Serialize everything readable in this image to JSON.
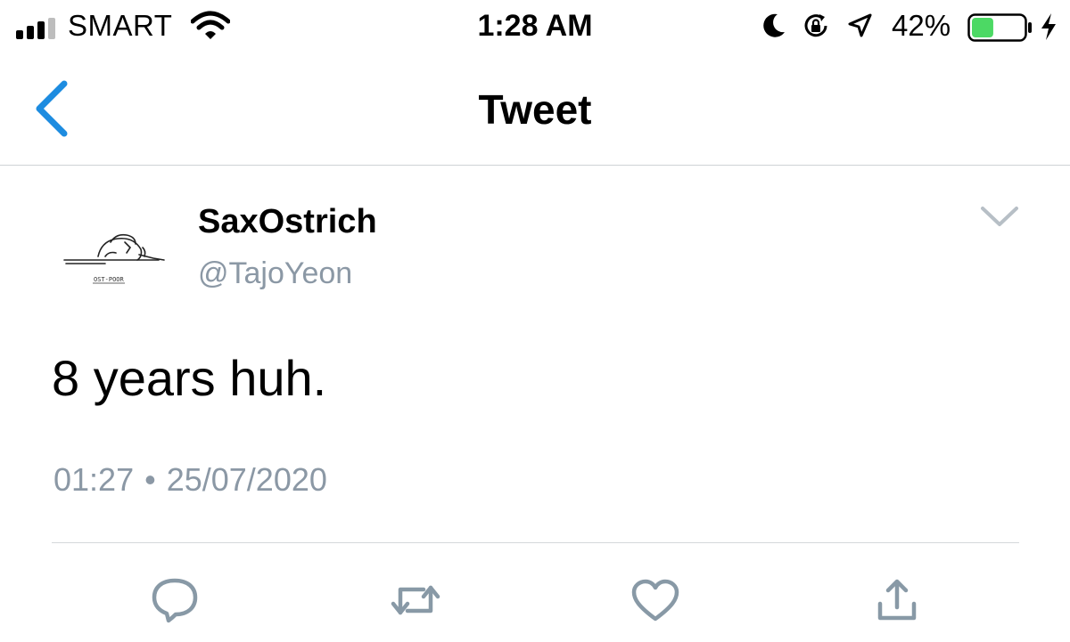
{
  "status_bar": {
    "carrier": "SMART",
    "time": "1:28 AM",
    "battery_percent": "42%",
    "battery_level": 0.42,
    "battery_color": "#4cd964",
    "icons": [
      "signal-icon",
      "wifi-icon",
      "moon-icon",
      "rotation-lock-icon",
      "location-icon",
      "battery-icon",
      "charging-bolt-icon"
    ]
  },
  "nav": {
    "title": "Tweet",
    "back_icon": "chevron-left-icon",
    "accent_color": "#1d8ce0"
  },
  "tweet": {
    "display_name": "SaxOstrich",
    "handle": "@TajoYeon",
    "avatar_caption": "OST-POOR",
    "text": "8 years huh.",
    "time": "01:27",
    "separator": "•",
    "date": "25/07/2020",
    "menu_icon": "chevron-down-icon"
  },
  "actions": {
    "icons": [
      "reply-icon",
      "retweet-icon",
      "like-icon",
      "share-icon"
    ],
    "icon_color": "#8899a6"
  }
}
